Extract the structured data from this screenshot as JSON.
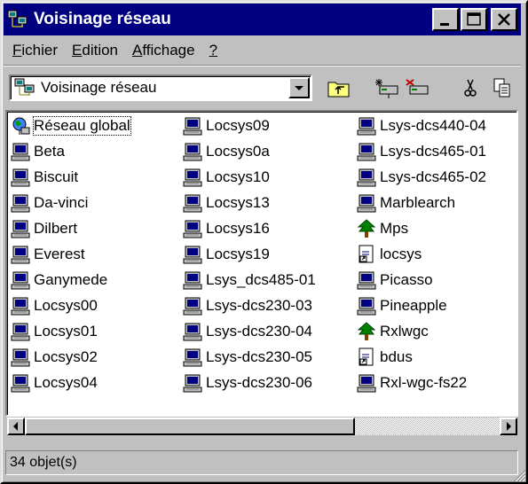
{
  "window": {
    "title": "Voisinage réseau"
  },
  "menu": [
    {
      "accel": "F",
      "rest": "ichier"
    },
    {
      "accel": "E",
      "rest": "dition"
    },
    {
      "accel": "A",
      "rest": "ffichage"
    },
    {
      "accel": "?",
      "rest": ""
    }
  ],
  "address": {
    "value": "Voisinage réseau"
  },
  "items": {
    "col1": [
      {
        "label": "Réseau global",
        "icon": "globe-network-icon",
        "selected": true
      },
      {
        "label": "Beta",
        "icon": "computer-icon"
      },
      {
        "label": "Biscuit",
        "icon": "computer-icon"
      },
      {
        "label": "Da-vinci",
        "icon": "computer-icon"
      },
      {
        "label": "Dilbert",
        "icon": "computer-icon"
      },
      {
        "label": "Everest",
        "icon": "computer-icon"
      },
      {
        "label": "Ganymede",
        "icon": "computer-icon"
      },
      {
        "label": "Locsys00",
        "icon": "computer-icon"
      },
      {
        "label": "Locsys01",
        "icon": "computer-icon"
      },
      {
        "label": "Locsys02",
        "icon": "computer-icon"
      },
      {
        "label": "Locsys04",
        "icon": "computer-icon"
      }
    ],
    "col2": [
      {
        "label": "Locsys09",
        "icon": "computer-icon"
      },
      {
        "label": "Locsys0a",
        "icon": "computer-icon"
      },
      {
        "label": "Locsys10",
        "icon": "computer-icon"
      },
      {
        "label": "Locsys13",
        "icon": "computer-icon"
      },
      {
        "label": "Locsys16",
        "icon": "computer-icon"
      },
      {
        "label": "Locsys19",
        "icon": "computer-icon"
      },
      {
        "label": "Lsys_dcs485-01",
        "icon": "computer-icon"
      },
      {
        "label": "Lsys-dcs230-03",
        "icon": "computer-icon"
      },
      {
        "label": "Lsys-dcs230-04",
        "icon": "computer-icon"
      },
      {
        "label": "Lsys-dcs230-05",
        "icon": "computer-icon"
      },
      {
        "label": "Lsys-dcs230-06",
        "icon": "computer-icon"
      }
    ],
    "col3": [
      {
        "label": "Lsys-dcs440-04",
        "icon": "computer-icon"
      },
      {
        "label": "Lsys-dcs465-01",
        "icon": "computer-icon"
      },
      {
        "label": "Lsys-dcs465-02",
        "icon": "computer-icon"
      },
      {
        "label": "Marblearch",
        "icon": "computer-icon"
      },
      {
        "label": "Mps",
        "icon": "tree-icon"
      },
      {
        "label": "locsys",
        "icon": "shortcut-icon"
      },
      {
        "label": "Picasso",
        "icon": "computer-icon"
      },
      {
        "label": "Pineapple",
        "icon": "computer-icon"
      },
      {
        "label": "Rxlwgc",
        "icon": "tree-icon"
      },
      {
        "label": "bdus",
        "icon": "shortcut-icon"
      },
      {
        "label": "Rxl-wgc-fs22",
        "icon": "computer-icon"
      }
    ]
  },
  "status": {
    "text": "34 objet(s)"
  }
}
